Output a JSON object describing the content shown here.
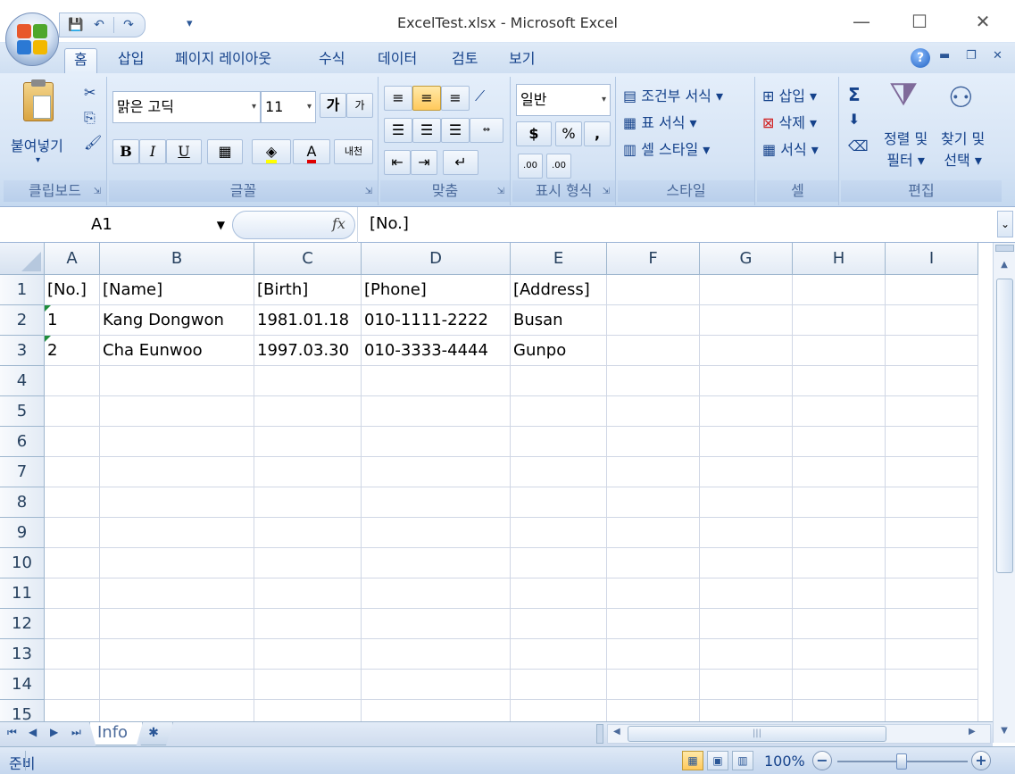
{
  "window": {
    "title": "ExcelTest.xlsx - Microsoft Excel",
    "minimize": "—",
    "maximize": "☐",
    "close": "✕"
  },
  "qat": {
    "save": "💾",
    "undo": "↶",
    "redo": "↷",
    "more": "▾"
  },
  "tabs": [
    "홈",
    "삽입",
    "페이지 레이아웃",
    "수식",
    "데이터",
    "검토",
    "보기"
  ],
  "ribbon": {
    "clipboard": {
      "paste_label": "붙여넣기",
      "group_label": "클립보드"
    },
    "font": {
      "font_name": "맑은 고딕",
      "font_size": "11",
      "grow": "가",
      "shrink": "가",
      "bold": "B",
      "italic": "I",
      "underline": "U",
      "color_a": "A",
      "phonetic": "내천",
      "group_label": "글꼴"
    },
    "alignment": {
      "group_label": "맞춤"
    },
    "number": {
      "format": "일반",
      "currency": "$",
      "percent": "%",
      "comma": ",",
      "inc_dec": ".00",
      "dec_dec": ".00",
      "group_label": "표시 형식"
    },
    "styles": {
      "conditional": "조건부 서식",
      "table": "표 서식",
      "cell_style": "셀 스타일",
      "group_label": "스타일"
    },
    "cells": {
      "insert": "삽입",
      "delete": "삭제",
      "format": "서식",
      "group_label": "셀"
    },
    "editing": {
      "sigma": "Σ",
      "sort_filter_line1": "정렬 및",
      "sort_filter_line2": "필터",
      "find_select_line1": "찾기 및",
      "find_select_line2": "선택",
      "group_label": "편집"
    }
  },
  "formula_bar": {
    "name_box": "A1",
    "fx": "fx",
    "value": "[No.]"
  },
  "sheet": {
    "columns": [
      "A",
      "B",
      "C",
      "D",
      "E",
      "F",
      "G",
      "H",
      "I"
    ],
    "rows": [
      "1",
      "2",
      "3",
      "4",
      "5",
      "6",
      "7",
      "8",
      "9",
      "10",
      "11",
      "12",
      "13",
      "14",
      "15"
    ],
    "data": [
      [
        "[No.]",
        "[Name]",
        "[Birth]",
        "[Phone]",
        "[Address]"
      ],
      [
        "1",
        "Kang Dongwon",
        "1981.01.18",
        "010-1111-2222",
        "Busan"
      ],
      [
        "2",
        "Cha Eunwoo",
        "1997.03.30",
        "010-3333-4444",
        "Gunpo"
      ]
    ]
  },
  "sheet_tabs": {
    "active": "Info"
  },
  "status": {
    "ready": "준비",
    "zoom": "100%"
  },
  "colors": {
    "ribbon_bg": "#dbe7f6",
    "text": "#15428b",
    "gridline": "#d0d7e5",
    "error_triangle": "#1e8c3a"
  }
}
